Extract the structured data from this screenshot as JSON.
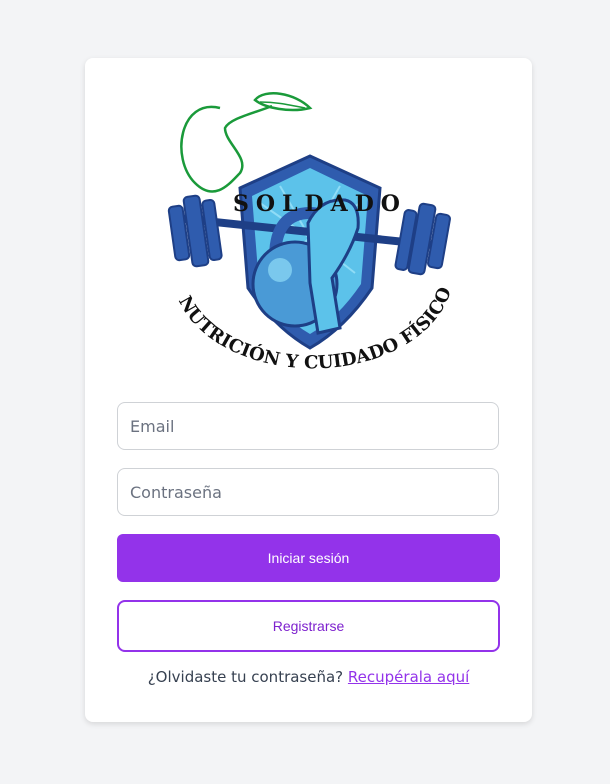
{
  "logo": {
    "brand": "SOLDADO",
    "tagline": "NUTRICIÓN Y CUIDADO FÍSICO"
  },
  "form": {
    "email_placeholder": "Email",
    "password_placeholder": "Contraseña",
    "login_label": "Iniciar sesión",
    "register_label": "Registrarse",
    "forgot_prefix": "¿Olvidaste tu contraseña?",
    "forgot_link": "Recupérala aquí"
  },
  "colors": {
    "accent": "#9333ea",
    "background": "#f3f4f6",
    "card": "#ffffff"
  }
}
